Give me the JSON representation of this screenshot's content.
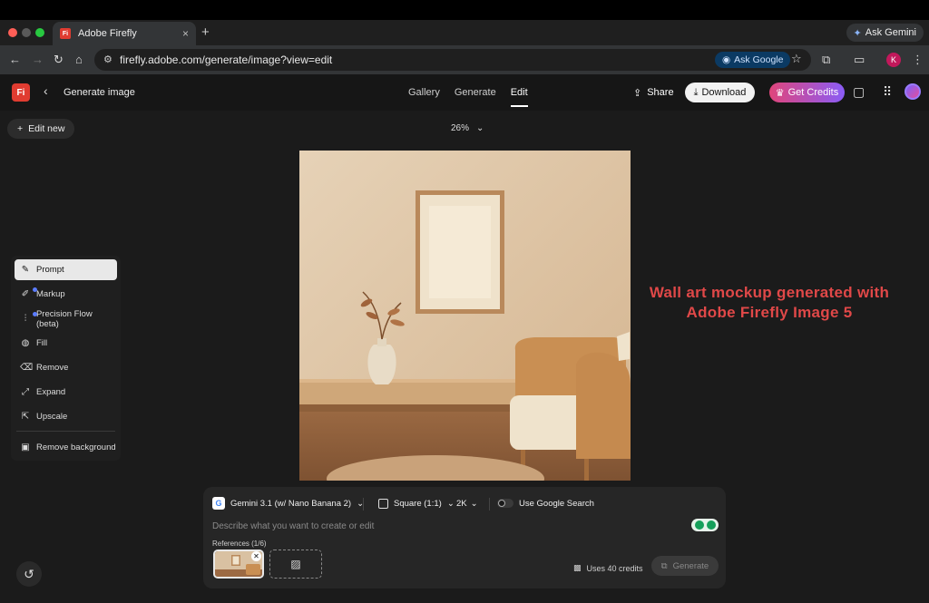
{
  "browser": {
    "tab_title": "Adobe Firefly",
    "tab_favicon": "Fi",
    "new_tab_glyph": "+",
    "close_glyph": "×",
    "ask_gemini_label": "Ask Gemini",
    "url": "firefly.adobe.com/generate/image?view=edit",
    "ask_google_label": "Ask Google",
    "profile_initial": "K"
  },
  "app": {
    "logo_text": "Fi",
    "page_title": "Generate image",
    "nav_tabs": [
      {
        "label": "Gallery"
      },
      {
        "label": "Generate"
      },
      {
        "label": "Edit",
        "active": true
      }
    ],
    "share_label": "Share",
    "download_label": "Download",
    "get_credits_label": "Get Credits"
  },
  "workspace": {
    "edit_new_label": "Edit new",
    "zoom_level": "26%",
    "tools": [
      {
        "label": "Prompt",
        "icon": "prompt-icon",
        "active": true
      },
      {
        "label": "Markup",
        "icon": "markup-icon",
        "new_dot": true
      },
      {
        "label": "Precision Flow (beta)",
        "icon": "precision-flow-icon",
        "new_dot": true
      },
      {
        "label": "Fill",
        "icon": "fill-icon"
      },
      {
        "label": "Remove",
        "icon": "remove-icon"
      },
      {
        "label": "Expand",
        "icon": "expand-icon"
      },
      {
        "label": "Upscale",
        "icon": "upscale-icon"
      },
      {
        "label": "Remove background",
        "icon": "remove-background-icon"
      }
    ]
  },
  "annotation": {
    "line1": "Wall art mockup generated with",
    "line2": "Adobe Firefly Image 5"
  },
  "prompt_bar": {
    "model_label": "Gemini 3.1 (w/ Nano Banana 2)",
    "aspect_label": "Square (1:1)",
    "resolution_label": "2K",
    "google_search_label": "Use Google Search",
    "google_search_enabled": false,
    "prompt_placeholder": "Describe what you want to create or edit",
    "prompt_value": "",
    "references_label": "References (1/6)",
    "credits_label": "Uses 40 credits",
    "generate_label": "Generate"
  },
  "colors": {
    "accent_red": "#e04848",
    "firefly_red": "#e03c31",
    "credits_gradient_start": "#e0457b",
    "credits_gradient_end": "#8a5cf6"
  }
}
